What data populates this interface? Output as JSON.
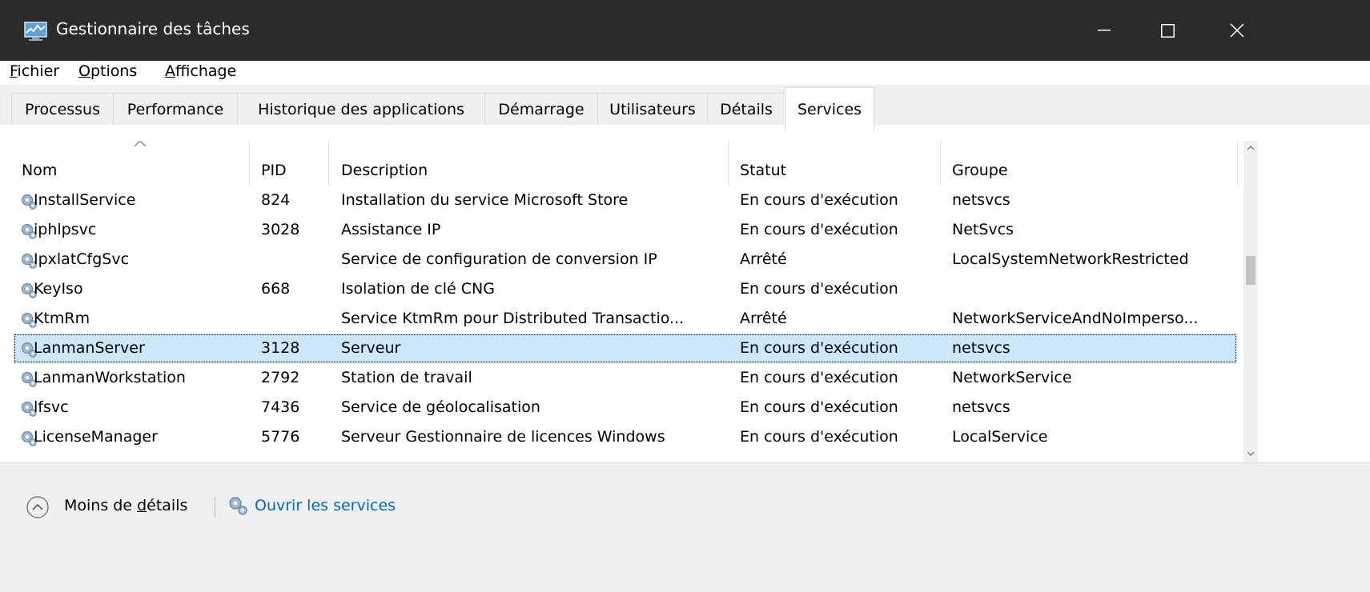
{
  "window": {
    "title": "Gestionnaire des tâches",
    "minimize_label": "—",
    "maximize_label": "☐",
    "close_label": "✕"
  },
  "menu": {
    "items": [
      {
        "label": "Fichier",
        "underline": "F"
      },
      {
        "label": "Options",
        "underline": "O"
      },
      {
        "label": "Affichage",
        "underline": "A"
      }
    ]
  },
  "tabs": [
    {
      "label": "Processus"
    },
    {
      "label": "Performance"
    },
    {
      "label": "Historique des applications"
    },
    {
      "label": "Démarrage"
    },
    {
      "label": "Utilisateurs"
    },
    {
      "label": "Détails"
    },
    {
      "label": "Services"
    }
  ],
  "table": {
    "headers": [
      "Nom",
      "PID",
      "Description",
      "Statut",
      "Groupe"
    ],
    "rows": [
      {
        "name": "InstallService",
        "pid": "824",
        "description": "Installation du service Microsoft Store",
        "status": "En cours d'exécution",
        "group": "netsvcs"
      },
      {
        "name": "iphlpsvc",
        "pid": "3028",
        "description": "Assistance IP",
        "status": "En cours d'exécution",
        "group": "NetSvcs"
      },
      {
        "name": "IpxlatCfgSvc",
        "pid": "",
        "description": "Service de configuration de conversion IP",
        "status": "Arrêté",
        "group": "LocalSystemNetworkRestricted"
      },
      {
        "name": "KeyIso",
        "pid": "668",
        "description": "Isolation de clé CNG",
        "status": "En cours d'exécution",
        "group": ""
      },
      {
        "name": "KtmRm",
        "pid": "",
        "description": "Service KtmRm pour Distributed Transactio...",
        "status": "Arrêté",
        "group": "NetworkServiceAndNoImperso..."
      },
      {
        "name": "LanmanServer",
        "pid": "3128",
        "description": "Serveur",
        "status": "En cours d'exécution",
        "group": "netsvcs"
      },
      {
        "name": "LanmanWorkstation",
        "pid": "2792",
        "description": "Station de travail",
        "status": "En cours d'exécution",
        "group": "NetworkService"
      },
      {
        "name": "lfsvc",
        "pid": "7436",
        "description": "Service de géolocalisation",
        "status": "En cours d'exécution",
        "group": "netsvcs"
      },
      {
        "name": "LicenseManager",
        "pid": "5776",
        "description": "Serveur Gestionnaire de licences Windows",
        "status": "En cours d'exécution",
        "group": "LocalService"
      }
    ],
    "selected_row": "LanmanServer"
  },
  "footer": {
    "less_details": "Moins de détails",
    "less_details_underline": "d",
    "open_services": "Ouvrir les services"
  },
  "colors": {
    "titlebar": "#2b2b2b",
    "selection": "#cce8ff",
    "link": "#0066cc"
  }
}
